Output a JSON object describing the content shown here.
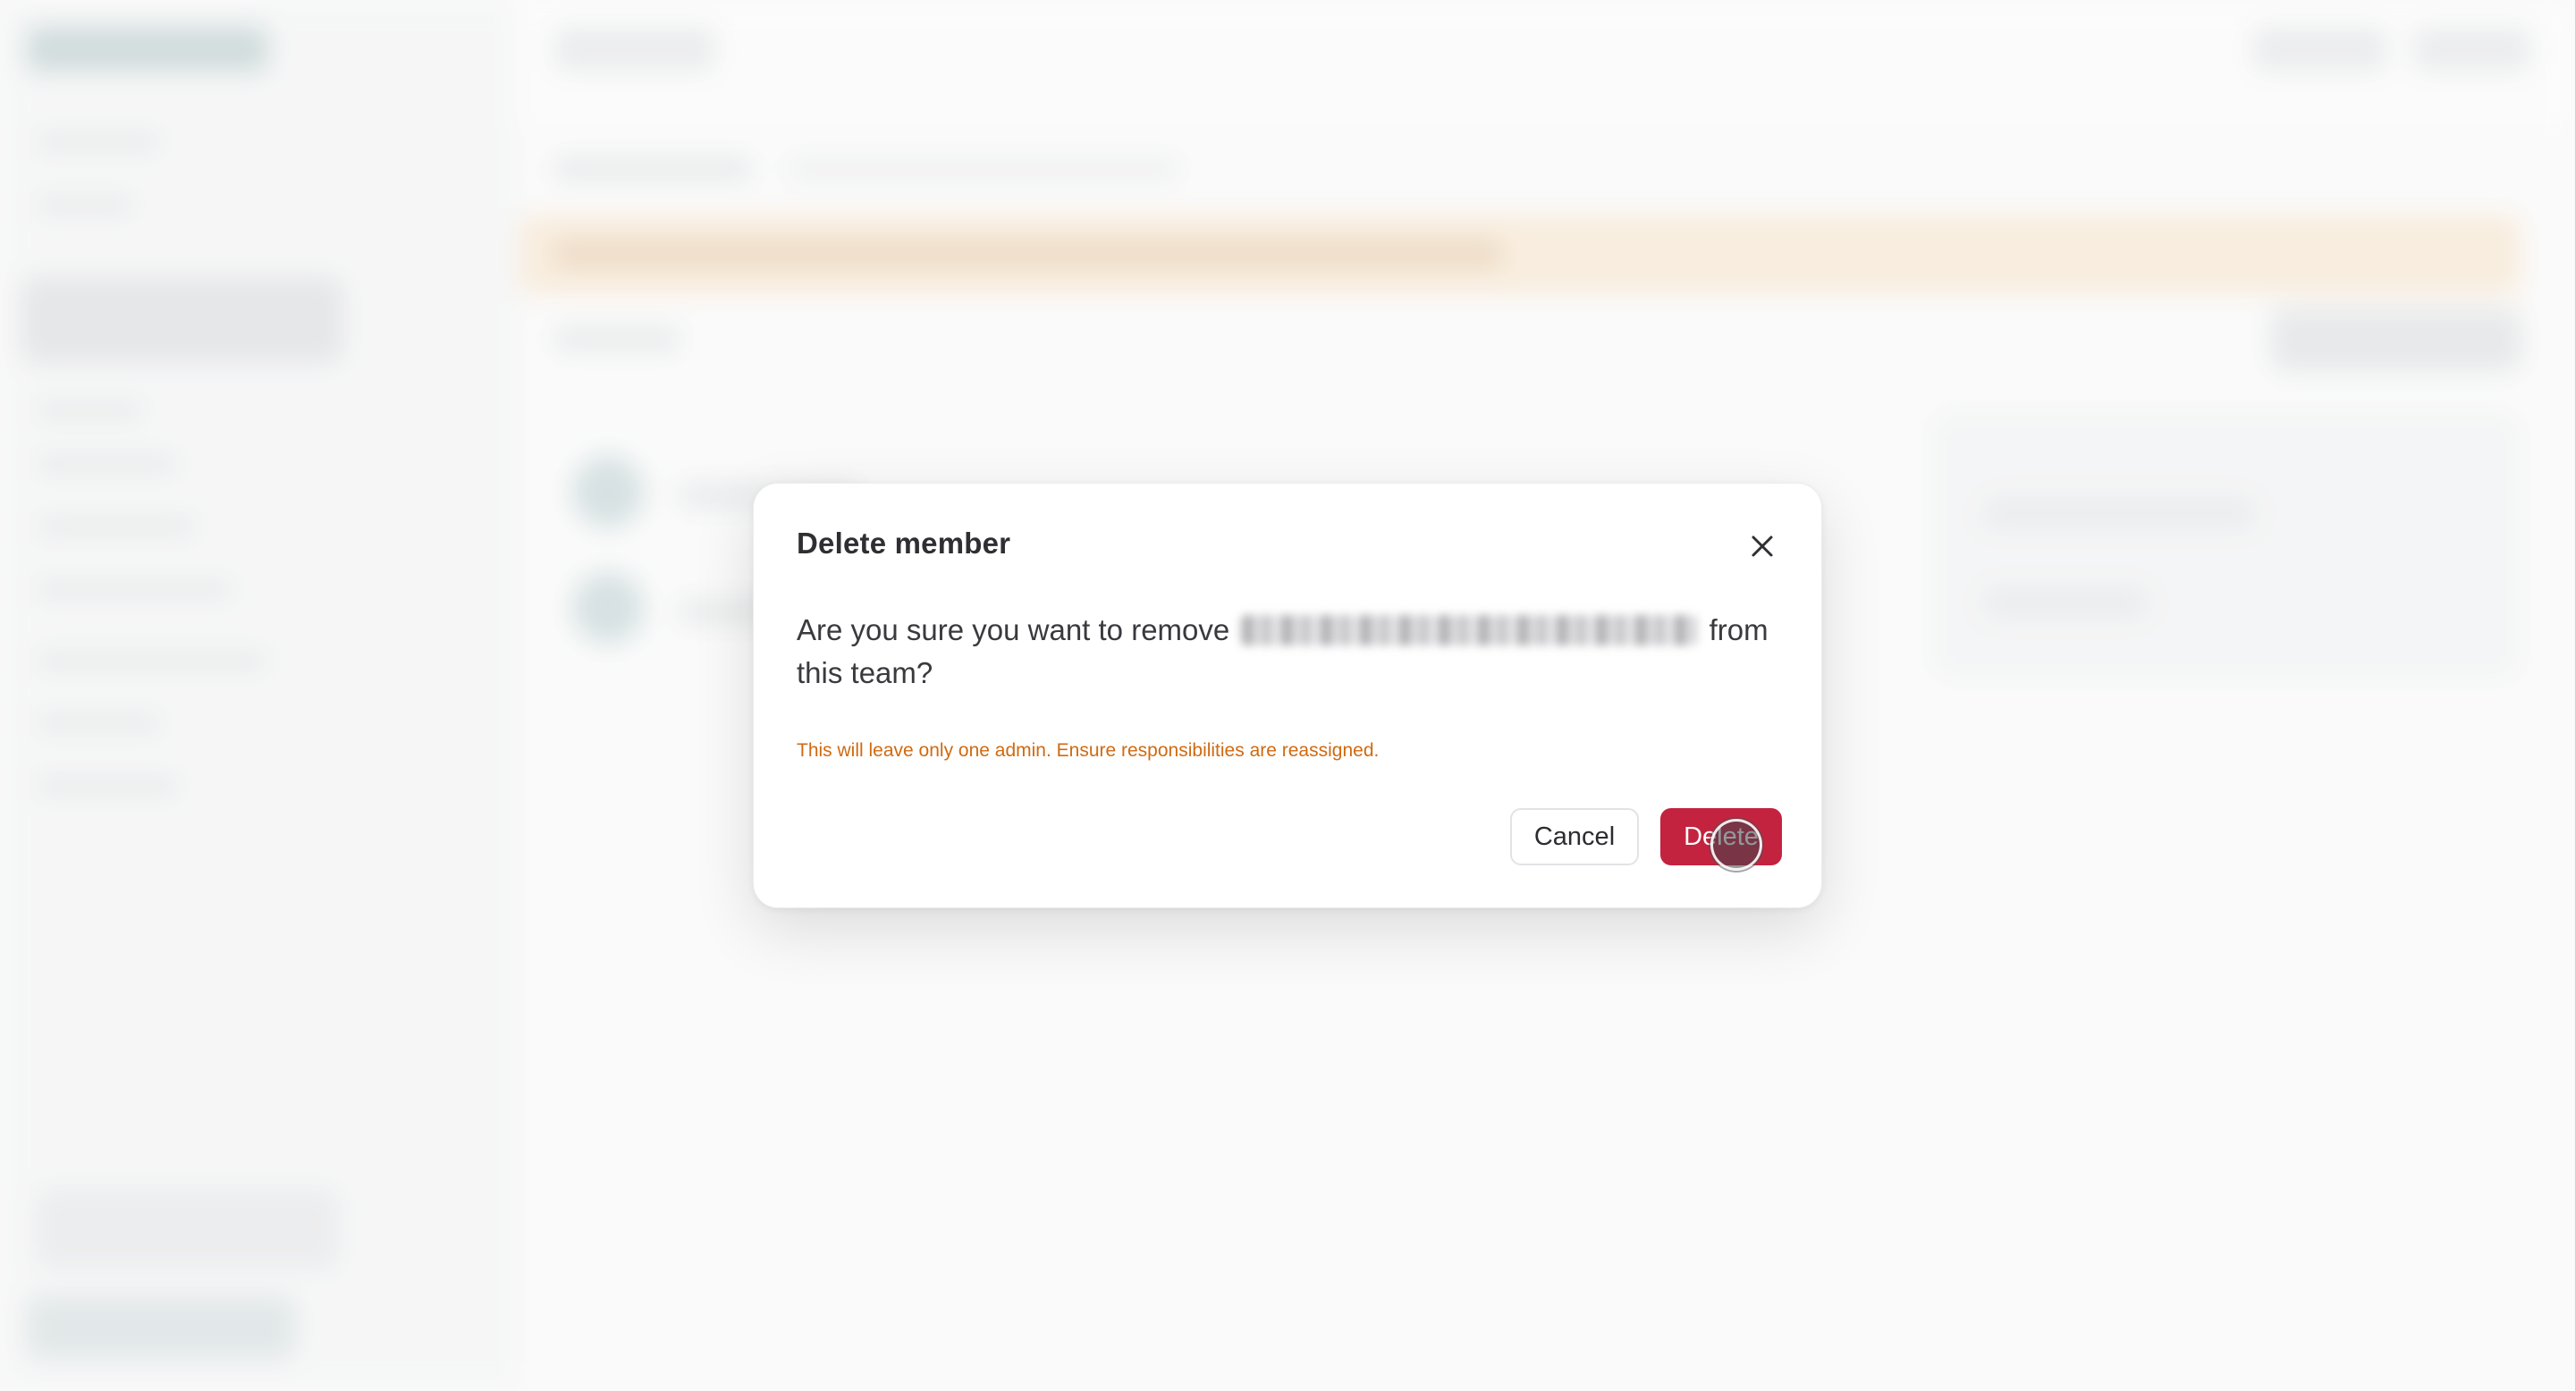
{
  "dialog": {
    "title": "Delete member",
    "message_prefix": "Are you sure you want to remove",
    "message_suffix": "from this team?",
    "warning": "This will leave only one admin. Ensure responsibilities are reassigned.",
    "cancel_label": "Cancel",
    "delete_label": "Delete",
    "close_icon": "close-icon"
  },
  "colors": {
    "danger": "#c3233f",
    "warning_text": "#d06a10",
    "title_text": "#2f2f33"
  }
}
